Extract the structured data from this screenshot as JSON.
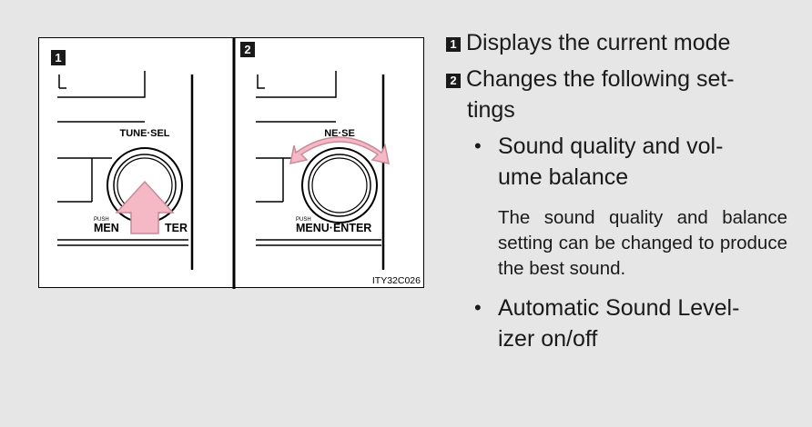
{
  "figure": {
    "panel1_number": "1",
    "panel2_number": "2",
    "knob_top_label": "TUNE·SEL",
    "knob_top_label_partial": "NE·SE",
    "push_label": "PUSH",
    "knob_bottom_label_left": "MEN",
    "knob_bottom_label_right": "TER",
    "knob_bottom_label_full": "MENU·ENTER",
    "image_code": "ITY32C026",
    "arrow_color": "#f5b9c6"
  },
  "items": {
    "item1_number": "1",
    "item1_text": "Displays the current mode",
    "item2_number": "2",
    "item2_text_line1": "Changes the following set-",
    "item2_text_line2": "tings",
    "bullet1_line1": "Sound quality and vol-",
    "bullet1_line2": "ume balance",
    "bullet1_note": "The sound quality and balance setting can be changed to produce the best sound.",
    "bullet2_line1": "Automatic Sound Level-",
    "bullet2_line2": "izer on/off"
  }
}
